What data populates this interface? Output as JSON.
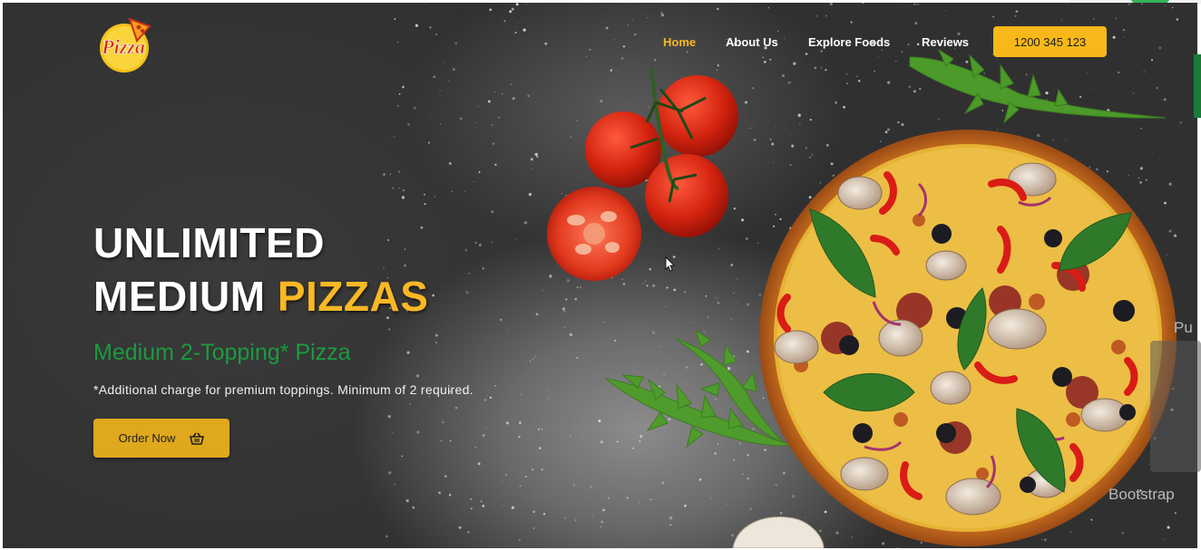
{
  "brand": {
    "logo_text": "Pizza"
  },
  "nav": {
    "items": [
      {
        "label": "Home",
        "active": true
      },
      {
        "label": "About Us",
        "active": false
      },
      {
        "label": "Explore Foods",
        "active": false
      },
      {
        "label": "Reviews",
        "active": false
      }
    ],
    "phone_button": "1200 345 123"
  },
  "hero": {
    "headline_line1": "UNLIMITED",
    "headline_line2_white": "MEDIUM",
    "headline_line2_accent": "PIZZAS",
    "subheading": "Medium 2-Topping* Pizza",
    "note": "*Additional charge for premium toppings. Minimum of 2 required.",
    "order_button": {
      "label": "Order Now",
      "icon": "basket-icon"
    }
  },
  "overlay": {
    "bootstrap_text": "Bootstrap",
    "partial_text": "Pu"
  },
  "colors": {
    "accent": "#f8b819",
    "green": "#1c9a3f",
    "background": "#303031"
  }
}
